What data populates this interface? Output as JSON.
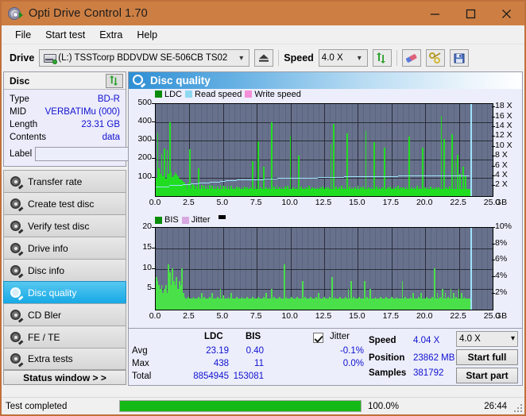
{
  "window": {
    "title": "Opti Drive Control 1.70",
    "icon": "disc-drive-icon",
    "minimize": "minimize-icon",
    "maximize": "maximize-icon",
    "close": "close-icon",
    "titlebar_color": "#cd7f43"
  },
  "menu": {
    "items": [
      "File",
      "Start test",
      "Extra",
      "Help"
    ]
  },
  "toolbar": {
    "drive_label": "Drive",
    "drive_value": "(L:)  TSSTcorp BDDVDW SE-506CB TS02",
    "eject_icon": "eject-icon",
    "speed_label": "Speed",
    "speed_value": "4.0 X",
    "refresh_icon": "refresh-icon",
    "erase_icon": "eraser-icon",
    "tools_icon": "wrench-icon",
    "save_icon": "save-icon"
  },
  "disc": {
    "header": "Disc",
    "refresh_icon": "refresh-arrows-icon",
    "rows": [
      {
        "name": "Type",
        "value": "BD-R"
      },
      {
        "name": "MID",
        "value": "VERBATIMu (000)"
      },
      {
        "name": "Length",
        "value": "23.31 GB"
      },
      {
        "name": "Contents",
        "value": "data"
      }
    ],
    "label_caption": "Label",
    "label_value": "",
    "label_placeholder": "",
    "disc_button_icon": "cd-icon"
  },
  "nav": {
    "items": [
      {
        "label": "Transfer rate",
        "active": false
      },
      {
        "label": "Create test disc",
        "active": false
      },
      {
        "label": "Verify test disc",
        "active": false
      },
      {
        "label": "Drive info",
        "active": false
      },
      {
        "label": "Disc info",
        "active": false
      },
      {
        "label": "Disc quality",
        "active": true
      },
      {
        "label": "CD Bler",
        "active": false
      },
      {
        "label": "FE / TE",
        "active": false
      },
      {
        "label": "Extra tests",
        "active": false
      }
    ],
    "status_window_button": "Status window > >"
  },
  "panel": {
    "title": "Disc quality",
    "icon": "disc-quality-icon"
  },
  "stats": {
    "col_ldc": "LDC",
    "col_bis": "BIS",
    "row_avg": "Avg",
    "row_max": "Max",
    "row_total": "Total",
    "ldc_avg": "23.19",
    "ldc_max": "438",
    "ldc_total": "8854945",
    "bis_avg": "0.40",
    "bis_max": "11",
    "bis_total": "153081",
    "jitter_label": "Jitter",
    "jitter_checked": true,
    "jitter_avg": "-0.1%",
    "jitter_max": "0.0%",
    "speed_label": "Speed",
    "speed_value": "4.04 X",
    "position_label": "Position",
    "position_value": "23862 MB",
    "samples_label": "Samples",
    "samples_value": "381792",
    "speed_select": "4.0 X",
    "start_full": "Start full",
    "start_part": "Start part"
  },
  "statusbar": {
    "message": "Test completed",
    "percent_text": "100.0%",
    "percent_value": 100,
    "elapsed": "26:44"
  },
  "chart_data": [
    {
      "id": "ldc-chart",
      "type": "bar",
      "title": "Disc quality",
      "xlabel": "GB",
      "ylabel": "LDC",
      "xlim": [
        0,
        25
      ],
      "ylim": [
        0,
        500
      ],
      "y2lim": [
        0,
        18
      ],
      "y2label": "X",
      "grid": true,
      "legend_position": "top-left",
      "legend": [
        {
          "name": "LDC",
          "color": "#0a8c0a"
        },
        {
          "name": "Read speed",
          "color": "#8fd8f2"
        },
        {
          "name": "Write speed",
          "color": "#f58fd8"
        }
      ],
      "xticks": [
        "0.0",
        "2.5",
        "5.0",
        "7.5",
        "10.0",
        "12.5",
        "15.0",
        "17.5",
        "20.0",
        "22.5",
        "25.0"
      ],
      "yticks": [
        100,
        200,
        300,
        400,
        500
      ],
      "y2ticks": [
        "2 X",
        "4 X",
        "6 X",
        "8 X",
        "10 X",
        "12 X",
        "14 X",
        "16 X",
        "18 X"
      ],
      "xunit": "GB",
      "data_end_x": 23.35,
      "series": [
        {
          "name": "LDC",
          "color": "#21dd21",
          "x": [
            0.05,
            0.15,
            0.25,
            0.35,
            0.45,
            0.55,
            0.65,
            0.75,
            0.85,
            0.95,
            1.05,
            1.15,
            1.25,
            1.35,
            1.45,
            1.55,
            1.65,
            1.75,
            1.85,
            1.95,
            2.05,
            2.15,
            2.25,
            2.4,
            2.55,
            2.7,
            2.85,
            3.0,
            3.2,
            3.4,
            3.6,
            3.8,
            4.0,
            4.2,
            4.4,
            4.6,
            4.8,
            5.0,
            5.2,
            5.4,
            5.6,
            5.8,
            6.0,
            6.2,
            6.4,
            6.6,
            6.8,
            7.0,
            7.2,
            7.4,
            7.6,
            7.8,
            8.0,
            8.2,
            8.4,
            8.6,
            8.8,
            9.0,
            9.2,
            9.4,
            9.6,
            9.8,
            10.0,
            10.2,
            10.4,
            10.6,
            10.8,
            11.0,
            11.2,
            11.4,
            11.6,
            11.8,
            12.0,
            12.2,
            12.4,
            12.6,
            12.8,
            13.0,
            13.2,
            13.4,
            13.6,
            13.8,
            14.0,
            14.2,
            14.4,
            14.6,
            14.8,
            15.0,
            15.2,
            15.4,
            15.6,
            15.8,
            16.0,
            16.2,
            16.4,
            16.6,
            16.8,
            17.0,
            17.2,
            17.4,
            17.6,
            17.8,
            18.0,
            18.2,
            18.4,
            18.6,
            18.8,
            19.0,
            19.2,
            19.4,
            19.6,
            19.8,
            20.0,
            20.2,
            20.4,
            20.6,
            20.8,
            21.0,
            21.2,
            21.4,
            21.6,
            21.8,
            22.0,
            22.2,
            22.4,
            22.6,
            22.8,
            23.0,
            23.2,
            23.3
          ],
          "y": [
            100,
            345,
            150,
            120,
            230,
            110,
            260,
            95,
            250,
            120,
            400,
            130,
            105,
            115,
            130,
            120,
            110,
            95,
            90,
            85,
            80,
            75,
            60,
            70,
            255,
            65,
            60,
            55,
            150,
            60,
            58,
            55,
            62,
            58,
            56,
            54,
            60,
            55,
            52,
            58,
            55,
            50,
            52,
            48,
            50,
            52,
            50,
            48,
            190,
            55,
            300,
            50,
            160,
            48,
            50,
            400,
            52,
            55,
            48,
            50,
            52,
            55,
            330,
            50,
            48,
            220,
            52,
            50,
            48,
            55,
            50,
            45,
            48,
            50,
            52,
            48,
            50,
            280,
            395,
            52,
            50,
            55,
            48,
            340,
            52,
            50,
            48,
            55,
            50,
            52,
            355,
            48,
            50,
            295,
            52,
            50,
            48,
            265,
            50,
            52,
            48,
            50,
            55,
            50,
            48,
            52,
            325,
            50,
            48,
            55,
            50,
            265,
            50,
            48,
            52,
            50,
            48,
            50,
            435,
            310,
            48,
            52,
            335,
            200,
            225,
            120,
            160,
            110
          ]
        },
        {
          "name": "Read speed",
          "color": "#9fe2fb",
          "x": [
            0.0,
            1.0,
            2.0,
            2.6,
            3.2,
            4.0,
            4.8,
            5.2,
            6.0,
            7.0,
            8.0,
            9.0,
            10.0,
            12.0,
            14.0,
            16.0,
            18.0,
            20.0,
            22.0,
            23.3
          ],
          "y_speed_x": [
            1.9,
            2.1,
            2.3,
            2.5,
            2.6,
            2.8,
            2.9,
            3.0,
            3.2,
            3.3,
            3.4,
            3.5,
            3.6,
            3.7,
            3.8,
            3.9,
            3.95,
            4.0,
            4.02,
            4.04
          ]
        }
      ]
    },
    {
      "id": "bis-chart",
      "type": "bar",
      "xlabel": "GB",
      "ylabel": "BIS",
      "xlim": [
        0,
        25
      ],
      "ylim": [
        0,
        20
      ],
      "y2lim": [
        0,
        10
      ],
      "y2label": "%",
      "grid": true,
      "legend_position": "top-left",
      "legend": [
        {
          "name": "BIS",
          "color": "#0a8c0a"
        },
        {
          "name": "Jitter",
          "color": "#d8a8e0"
        }
      ],
      "xticks": [
        "0.0",
        "2.5",
        "5.0",
        "7.5",
        "10.0",
        "12.5",
        "15.0",
        "17.5",
        "20.0",
        "22.5",
        "25.0"
      ],
      "yticks": [
        5,
        10,
        15,
        20
      ],
      "y2ticks": [
        "2%",
        "4%",
        "6%",
        "8%",
        "10%"
      ],
      "xunit": "GB",
      "data_end_x": 23.35,
      "series": [
        {
          "name": "BIS",
          "color": "#3ce03c",
          "x": [
            0.05,
            0.15,
            0.25,
            0.35,
            0.45,
            0.55,
            0.65,
            0.75,
            0.85,
            0.95,
            1.05,
            1.15,
            1.25,
            1.35,
            1.45,
            1.55,
            1.65,
            1.75,
            1.85,
            1.95,
            2.05,
            2.15,
            2.25,
            2.4,
            2.6,
            2.8,
            3.0,
            3.2,
            3.4,
            3.6,
            3.8,
            4.0,
            4.2,
            4.4,
            4.6,
            4.8,
            5.0,
            5.2,
            5.4,
            5.6,
            5.8,
            6.0,
            6.2,
            6.4,
            6.6,
            6.8,
            7.0,
            7.2,
            7.4,
            7.6,
            7.8,
            8.0,
            8.2,
            8.4,
            8.6,
            8.8,
            9.0,
            9.2,
            9.4,
            9.55,
            9.7,
            9.9,
            10.1,
            10.3,
            10.5,
            10.7,
            10.9,
            11.1,
            11.3,
            11.5,
            11.7,
            11.9,
            12.1,
            12.3,
            12.5,
            12.7,
            12.9,
            13.1,
            13.3,
            13.5,
            13.7,
            13.9,
            14.1,
            14.3,
            14.5,
            14.7,
            14.9,
            15.1,
            15.3,
            15.5,
            15.7,
            15.9,
            16.1,
            16.3,
            16.5,
            16.7,
            16.9,
            17.1,
            17.3,
            17.5,
            17.7,
            17.9,
            18.1,
            18.3,
            18.5,
            18.7,
            18.9,
            19.1,
            19.3,
            19.5,
            19.7,
            19.9,
            20.1,
            20.3,
            20.5,
            20.7,
            20.9,
            21.1,
            21.3,
            21.5,
            21.7,
            21.9,
            22.1,
            22.3,
            22.5,
            22.7,
            22.9,
            23.1,
            23.3
          ],
          "y": [
            8,
            7,
            6,
            5,
            6,
            4,
            5,
            6,
            4,
            11,
            9,
            6,
            10,
            7,
            6,
            8,
            5,
            7,
            6,
            10,
            4,
            3,
            2.5,
            3,
            2.5,
            3,
            2.5,
            3,
            4,
            3,
            2.5,
            3,
            4,
            2.5,
            3,
            5,
            3.5,
            2.5,
            3,
            4,
            2.5,
            3,
            2.5,
            3,
            2.5,
            3,
            2.5,
            3,
            2.5,
            3,
            2.5,
            3,
            4,
            2.5,
            5,
            3,
            2.5,
            3,
            2.5,
            11,
            3,
            2.5,
            3,
            2.5,
            3,
            2.5,
            7,
            3,
            2.5,
            3,
            2.5,
            3,
            4,
            2.5,
            3,
            2.5,
            3,
            8,
            3,
            2.5,
            3,
            2.5,
            3,
            5,
            7,
            3,
            2.5,
            3,
            2.5,
            7,
            3,
            5,
            2.5,
            3,
            2.5,
            3,
            2.5,
            3,
            2.5,
            3,
            2.5,
            3,
            2.5,
            7,
            3,
            2.5,
            3,
            4,
            2.5,
            3,
            4,
            2.5,
            3,
            2.5,
            3,
            10,
            4,
            3,
            5,
            4,
            3,
            5,
            4,
            3,
            5,
            4,
            3
          ]
        }
      ]
    }
  ]
}
